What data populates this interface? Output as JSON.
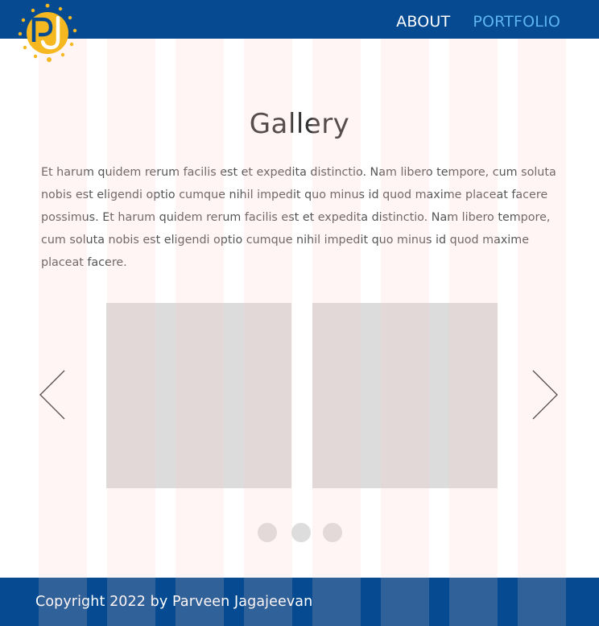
{
  "header": {
    "logo_text": "PJ",
    "nav": [
      {
        "label": "ABOUT",
        "active": false
      },
      {
        "label": "PORTFOLIO",
        "active": true
      }
    ]
  },
  "main": {
    "title": "Gallery",
    "paragraph": "Et harum quidem rerum facilis est et expedita distinctio. Nam libero tempore, cum soluta nobis est eligendi optio cumque nihil impedit quo minus id quod maxime placeat facere possimus. Et harum quidem rerum facilis est et expedita distinctio. Nam libero tempore, cum soluta nobis est eligendi optio cumque nihil impedit quo minus id quod maxime placeat facere."
  },
  "carousel": {
    "prev_icon": "chevron-left-icon",
    "next_icon": "chevron-right-icon",
    "slide_count": 2,
    "indicator_count": 3
  },
  "footer": {
    "copyright": "Copyright 2022 by Parveen Jagajeevan"
  },
  "colors": {
    "brand_blue": "#064b91",
    "active_link": "#5db4f0",
    "logo_yellow": "#f5b820",
    "placeholder_gray": "#dcdcdc",
    "grid_overlay": "#fac8c3"
  }
}
